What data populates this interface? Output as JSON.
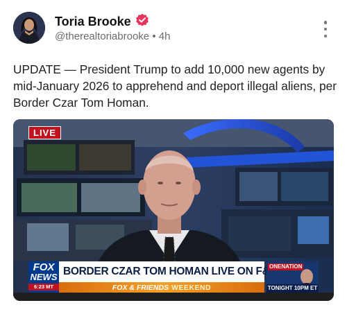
{
  "author": {
    "name": "Toria Brooke",
    "handle": "@therealtoriabrooke",
    "separator": "•",
    "time": "4h",
    "verified_color": "#e8345c"
  },
  "post": {
    "text": "UPDATE — President Trump to add 10,000 new agents by mid-January 2026 to apprehend and deport illegal aliens, per Border Czar Tom Homan."
  },
  "media": {
    "live_label": "LIVE",
    "channel_line1": "FOX",
    "channel_line2": "NEWS",
    "timestamp": "6:23 MT",
    "headline": "BORDER CZAR TOM HOMAN LIVE ON F&F",
    "show_name": "FOX & FRIENDS",
    "show_suffix": "WEEKEND",
    "promo_title": "ONENATION",
    "promo_time": "TONIGHT 10PM ET"
  },
  "icons": {
    "more": "more-vertical-icon",
    "verified": "verified-badge-icon"
  }
}
